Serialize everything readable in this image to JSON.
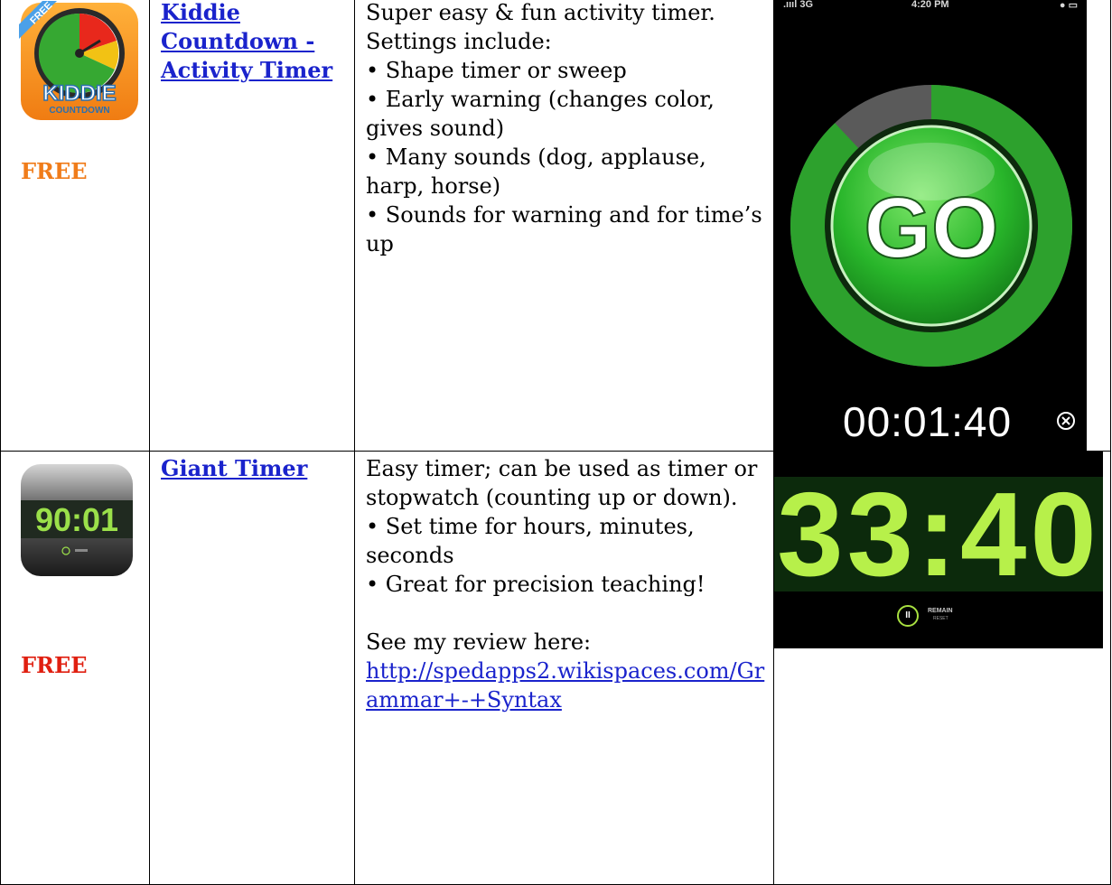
{
  "rows": [
    {
      "icon": "kiddie-countdown-app-icon",
      "icon_text": "KIDDIE",
      "icon_subtext": "COUNTDOWN",
      "icon_ribbon": "FREE",
      "price": "FREE",
      "price_color": "#f07c1a",
      "title": "Kiddie Countdown - Activity Timer",
      "description": [
        "Super easy & fun activity timer.",
        "Settings include:",
        "• Shape timer or sweep",
        "• Early warning (changes color, gives sound)",
        "• Many sounds (dog, applause, harp, horse)",
        "• Sounds for warning and for time’s up"
      ],
      "screenshot": {
        "status_signal": ".ıııl 3G",
        "status_time": "4:20 PM",
        "button_label": "GO",
        "countdown": "00:01:40",
        "remaining_fraction": 0.88,
        "ring_color": "#2da12d"
      }
    },
    {
      "icon": "giant-timer-app-icon",
      "icon_text": "90:01",
      "price": "FREE",
      "price_color": "#e01f10",
      "title": "Giant Timer",
      "description": [
        "Easy timer;  can be used as timer or stopwatch (counting up or down).",
        "• Set time for hours, minutes, seconds",
        "• Great for precision teaching!"
      ],
      "review_intro": "See my review here:",
      "review_link": "http://spedapps2.wikispaces.com/Grammar+-+Syntax",
      "screenshot": {
        "digits": "33:40",
        "control_label": "REMAIN",
        "control_sublabel": "RESET",
        "digit_color": "#b7f04a"
      }
    }
  ]
}
